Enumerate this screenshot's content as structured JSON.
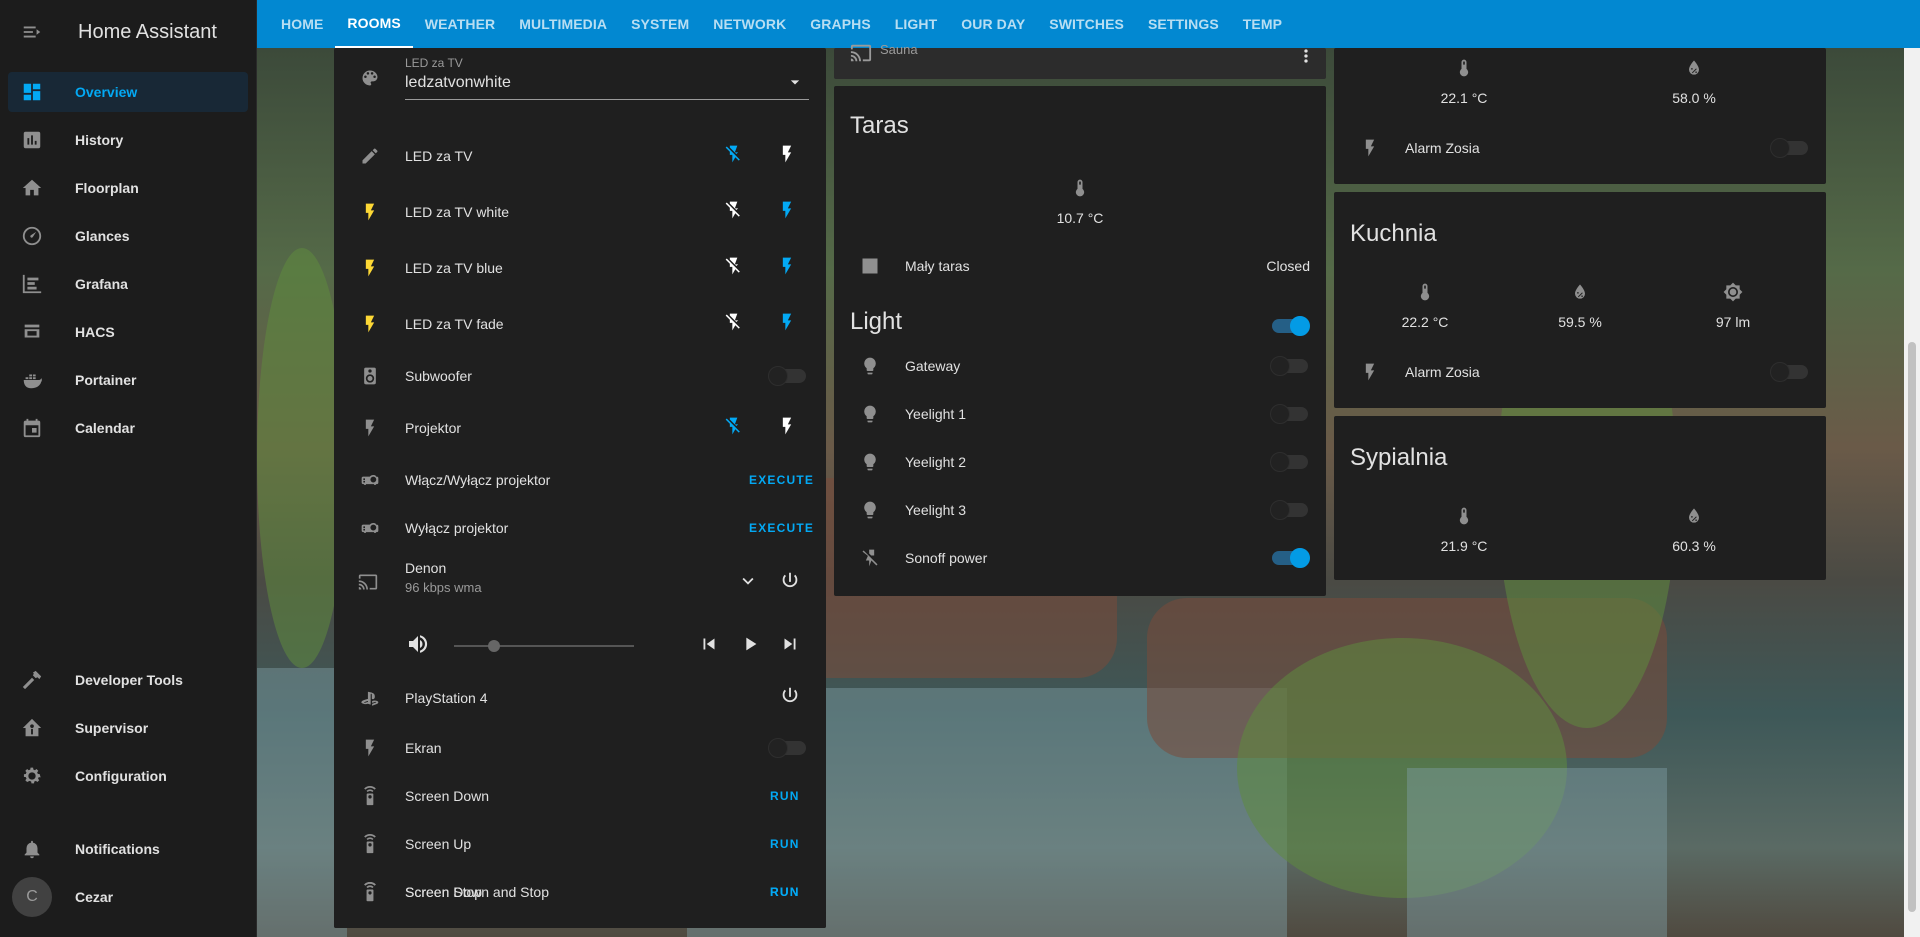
{
  "app": {
    "title": "Home Assistant"
  },
  "sidebar": {
    "items": [
      {
        "label": "Overview",
        "icon": "view-dashboard-icon",
        "active": true
      },
      {
        "label": "History",
        "icon": "chart-box-icon"
      },
      {
        "label": "Floorplan",
        "icon": "home-icon"
      },
      {
        "label": "Glances",
        "icon": "gauge-icon"
      },
      {
        "label": "Grafana",
        "icon": "chart-timeline-icon"
      },
      {
        "label": "HACS",
        "icon": "hacs-icon"
      },
      {
        "label": "Portainer",
        "icon": "docker-icon"
      },
      {
        "label": "Calendar",
        "icon": "calendar-icon"
      }
    ],
    "bottom": [
      {
        "label": "Developer Tools",
        "icon": "hammer-icon"
      },
      {
        "label": "Supervisor",
        "icon": "home-assistant-icon"
      },
      {
        "label": "Configuration",
        "icon": "cog-icon"
      },
      {
        "label": "Notifications",
        "icon": "bell-icon"
      }
    ],
    "user": {
      "name": "Cezar",
      "initial": "C"
    }
  },
  "tabs": [
    "HOME",
    "ROOMS",
    "WEATHER",
    "MULTIMEDIA",
    "SYSTEM",
    "NETWORK",
    "GRAPHS",
    "LIGHT",
    "OUR DAY",
    "SWITCHES",
    "SETTINGS",
    "TEMP"
  ],
  "active_tab": "ROOMS",
  "left_card": {
    "select": {
      "label": "LED za TV",
      "value": "ledzatvonwhite"
    },
    "rows": {
      "led_tv": "LED za TV",
      "led_tv_white": "LED za TV white",
      "led_tv_blue": "LED za TV blue",
      "led_tv_fade": "LED za TV fade",
      "subwoofer": "Subwoofer",
      "projektor": "Projektor",
      "wlacz_projektor": "Włącz/Wyłącz projektor",
      "wylacz_projektor": "Wyłącz projektor",
      "execute": "EXECUTE",
      "denon": "Denon",
      "denon_sub": "96 kbps wma",
      "volume_level": 0.22,
      "playstation": "PlayStation 4",
      "ekran": "Ekran",
      "screen_down": "Screen Down",
      "screen_up": "Screen Up",
      "screen_stop": "Screen Stop",
      "screen_down_stop": "Screen Down and Stop",
      "run": "RUN"
    }
  },
  "middle": {
    "sauna": "Sauna",
    "taras": {
      "title": "Taras",
      "temp": "10.7 °C",
      "cover": "Mały taras",
      "cover_state": "Closed"
    },
    "light": {
      "title": "Light",
      "items": [
        {
          "label": "Gateway",
          "on": false
        },
        {
          "label": "Yeelight 1",
          "on": false
        },
        {
          "label": "Yeelight 2",
          "on": false
        },
        {
          "label": "Yeelight 3",
          "on": false
        },
        {
          "label": "Sonoff power",
          "on": true
        }
      ]
    }
  },
  "right": {
    "top": {
      "temp": "22.1 °C",
      "humidity": "58.0 %",
      "alarm": "Alarm Zosia"
    },
    "kuchnia": {
      "title": "Kuchnia",
      "temp": "22.2 °C",
      "humidity": "59.5 %",
      "lux": "97 lm",
      "alarm": "Alarm Zosia"
    },
    "sypialnia": {
      "title": "Sypialnia",
      "temp": "21.9 °C",
      "humidity": "60.3 %"
    }
  },
  "colors": {
    "accent": "#03a9f4",
    "topbar": "#0288d1",
    "bolt": "#fdd835",
    "card": "#1f1f1f"
  }
}
